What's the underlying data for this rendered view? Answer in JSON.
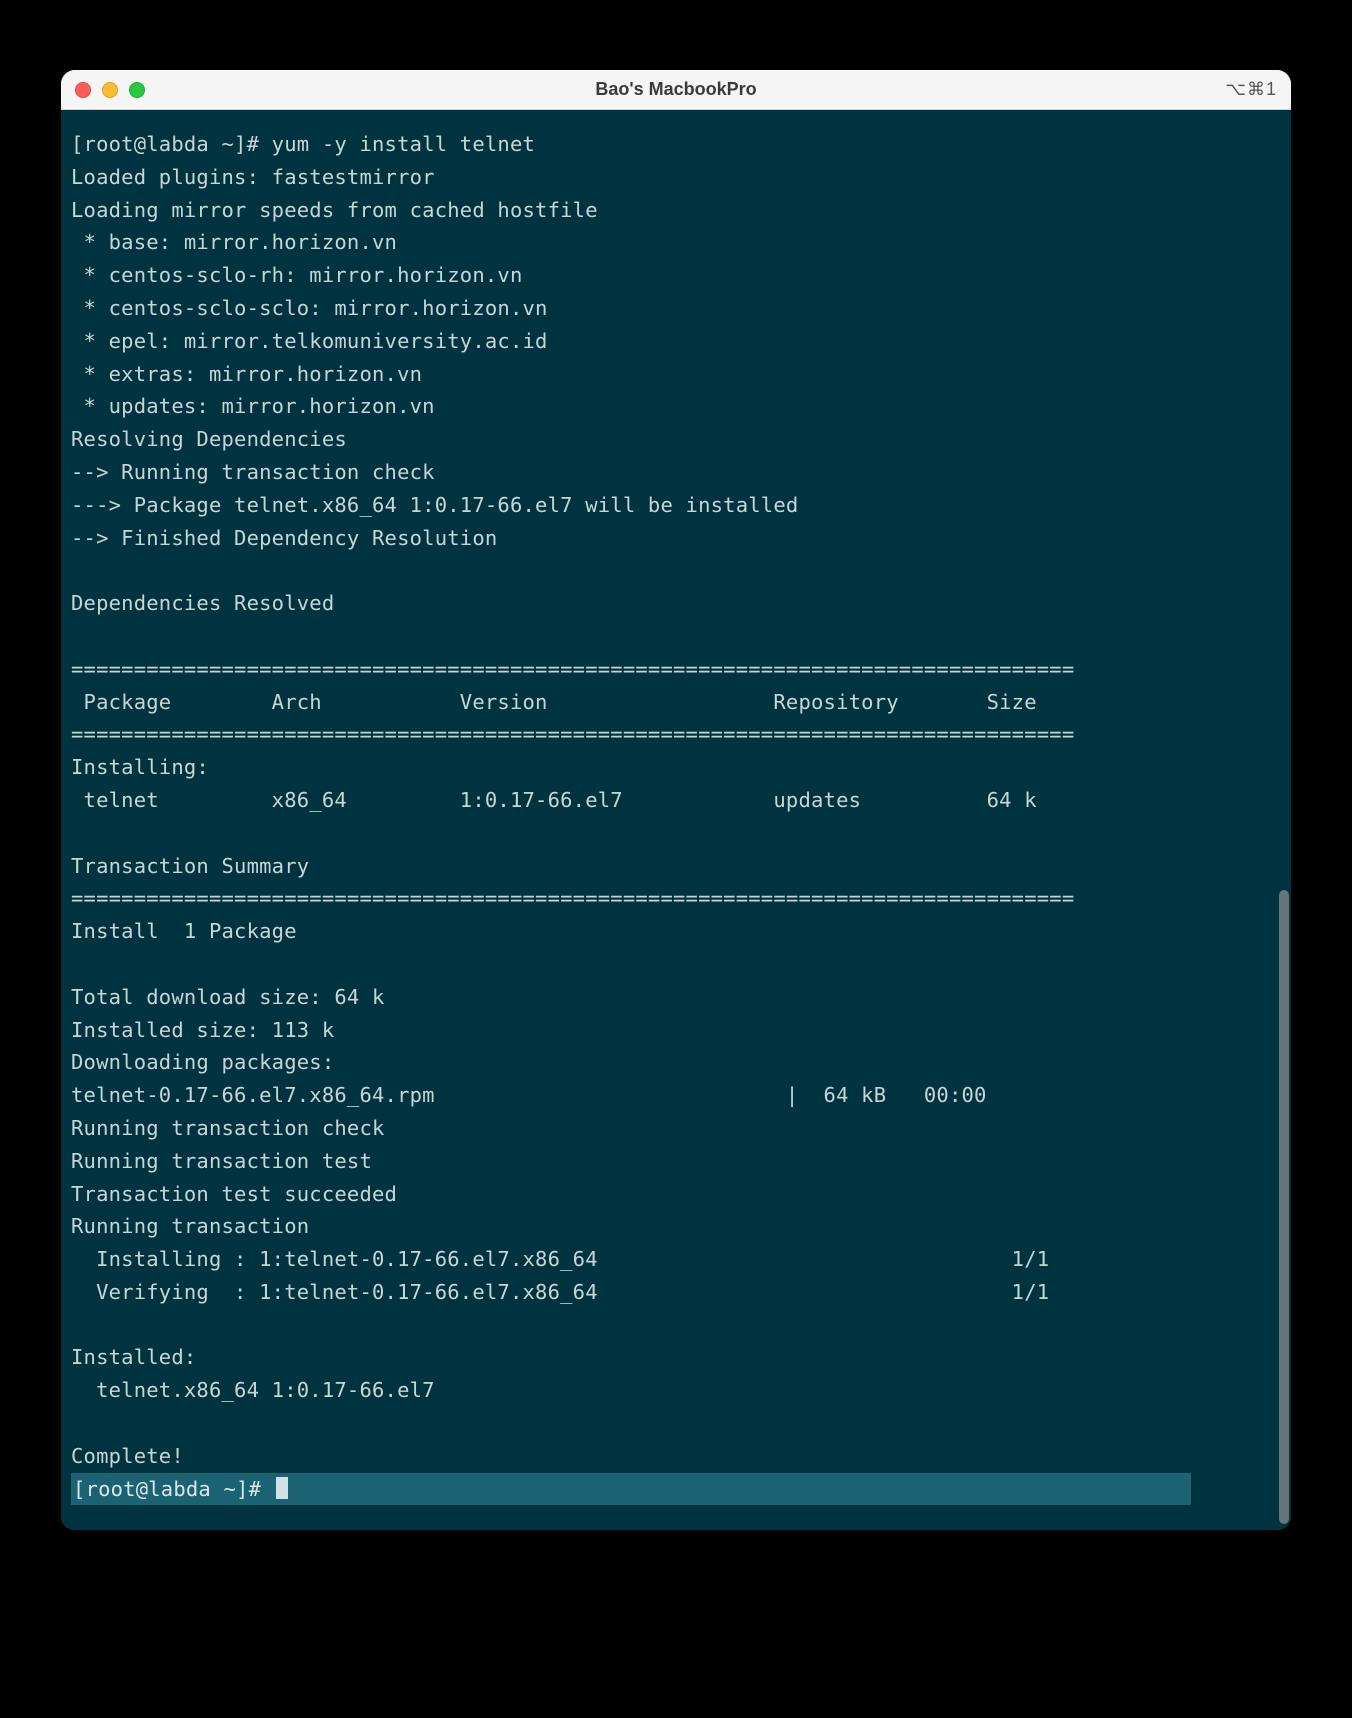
{
  "window": {
    "title": "Bao's MacbookPro",
    "shortcut": "⌥⌘1"
  },
  "terminal": {
    "prompt1_full": "[root@labda ~]# yum -y install telnet",
    "body": "Loaded plugins: fastestmirror\nLoading mirror speeds from cached hostfile\n * base: mirror.horizon.vn\n * centos-sclo-rh: mirror.horizon.vn\n * centos-sclo-sclo: mirror.horizon.vn\n * epel: mirror.telkomuniversity.ac.id\n * extras: mirror.horizon.vn\n * updates: mirror.horizon.vn\nResolving Dependencies\n--> Running transaction check\n---> Package telnet.x86_64 1:0.17-66.el7 will be installed\n--> Finished Dependency Resolution\n\nDependencies Resolved\n\n================================================================================\n Package        Arch           Version                  Repository       Size\n================================================================================\nInstalling:\n telnet         x86_64         1:0.17-66.el7            updates          64 k\n\nTransaction Summary\n================================================================================\nInstall  1 Package\n\nTotal download size: 64 k\nInstalled size: 113 k\nDownloading packages:\ntelnet-0.17-66.el7.x86_64.rpm                            |  64 kB   00:00     \nRunning transaction check\nRunning transaction test\nTransaction test succeeded\nRunning transaction\n  Installing : 1:telnet-0.17-66.el7.x86_64                                 1/1 \n  Verifying  : 1:telnet-0.17-66.el7.x86_64                                 1/1 \n\nInstalled:\n  telnet.x86_64 1:0.17-66.el7                                                   \n\nComplete!",
    "prompt2": "[root@labda ~]# "
  }
}
